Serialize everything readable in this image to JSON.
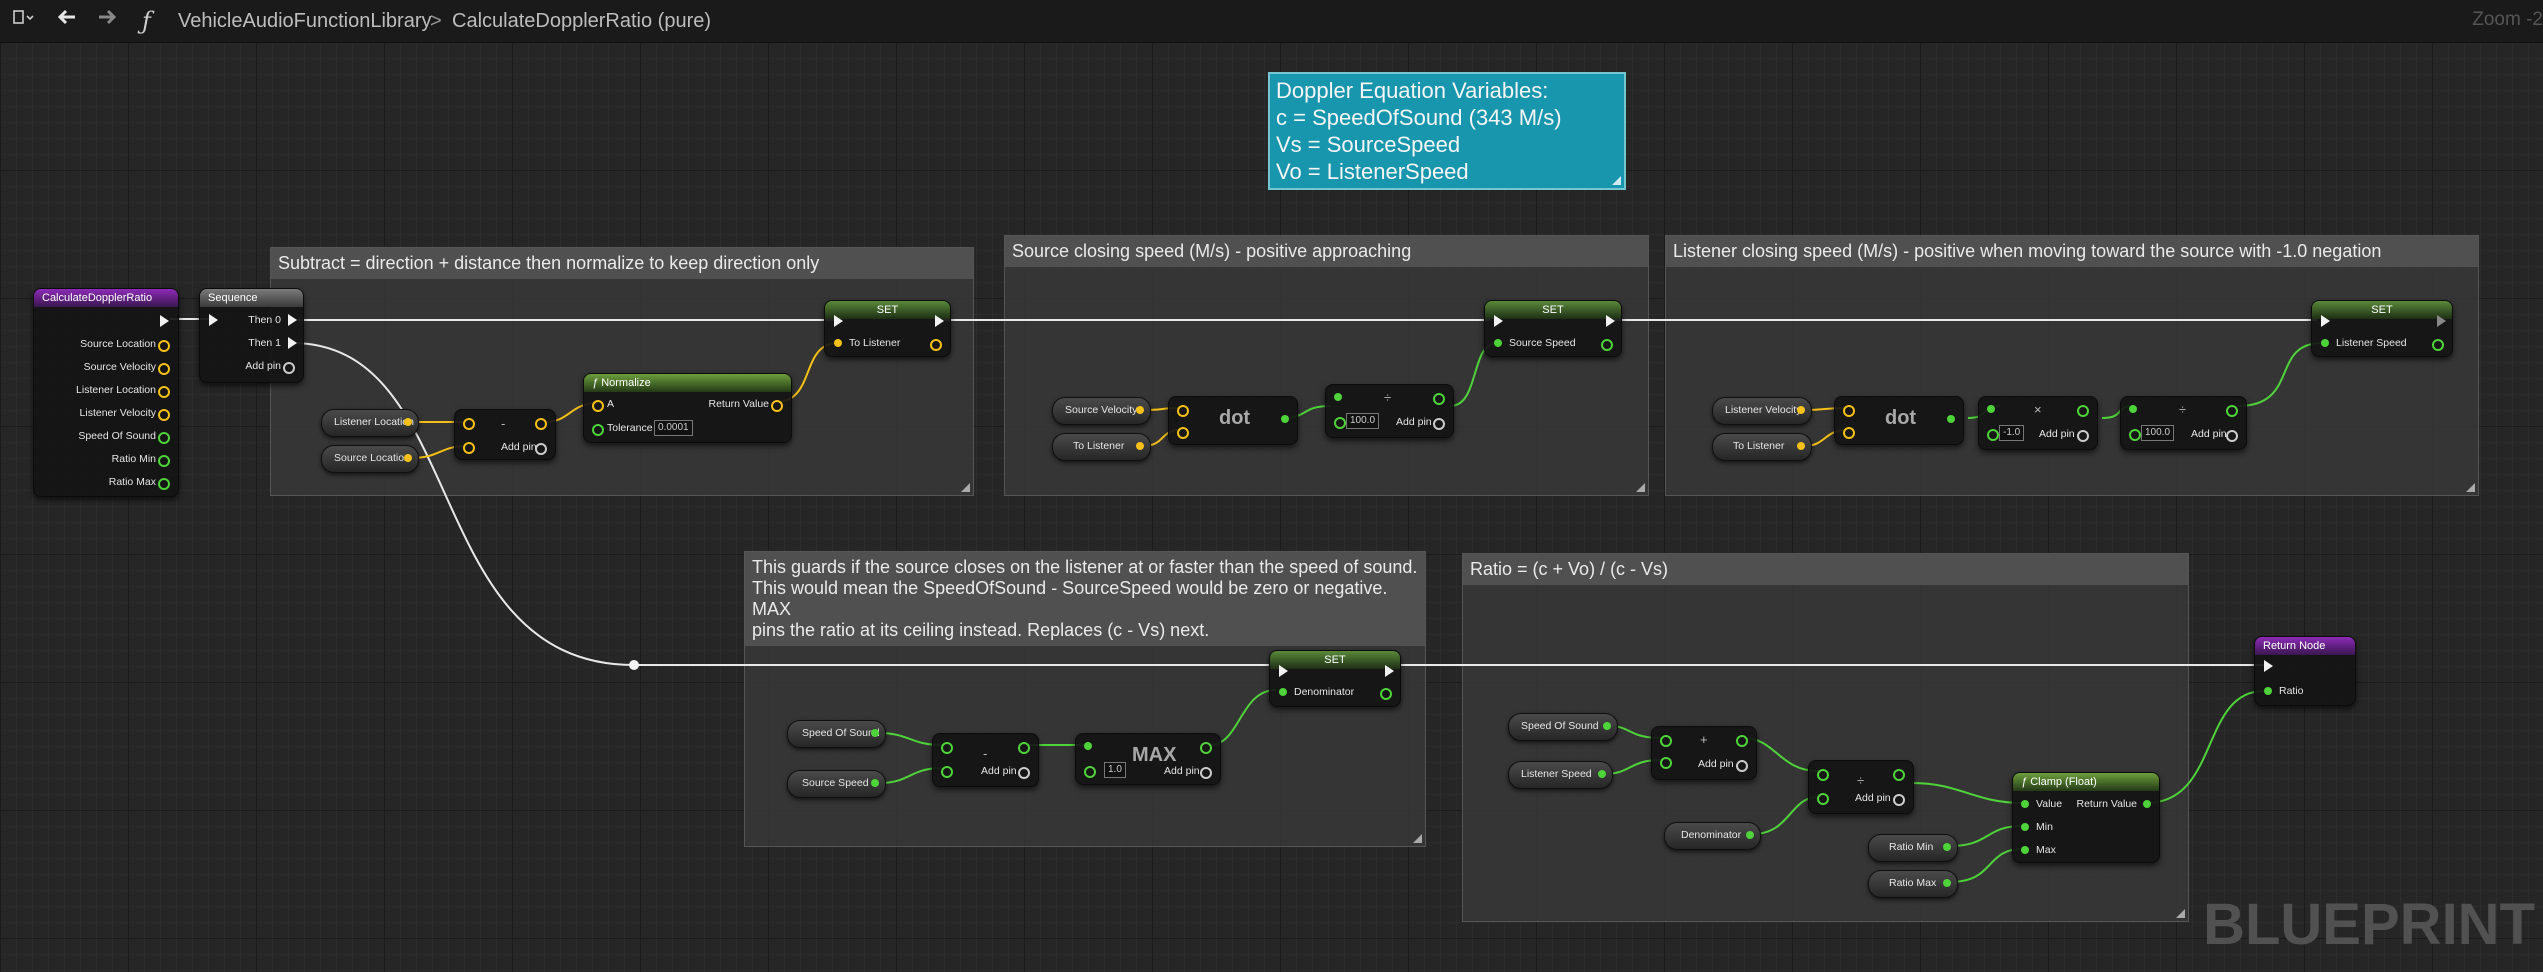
{
  "toolbar": {
    "breadcrumb_library": "VehicleAudioFunctionLibrary",
    "breadcrumb_separator": ">",
    "breadcrumb_function": "CalculateDopplerRatio (pure)",
    "zoom": "Zoom -2",
    "function_icon": "function-icon",
    "back_icon": "back-arrow-icon",
    "forward_icon": "forward-arrow-icon"
  },
  "watermark": "BLUEPRINT",
  "note": {
    "lines": [
      "Doppler Equation Variables:",
      "c = SpeedOfSound (343 M/s)",
      "Vs = SourceSpeed",
      "Vo = ListenerSpeed"
    ]
  },
  "comments": {
    "subtract": "Subtract = direction + distance then normalize to keep direction only",
    "source_closing": "Source closing speed (M/s) - positive approaching",
    "listener_closing": "Listener closing speed (M/s) - positive when moving toward the source with -1.0 negation",
    "guard_lines": [
      "This guards if the source closes on the listener at or faster than the speed of sound.",
      "This would mean the SpeedOfSound - SourceSpeed would be zero or negative. MAX",
      "pins the ratio at its ceiling instead. Replaces (c - Vs) next."
    ],
    "ratio": "Ratio = (c + Vo) / (c - Vs)"
  },
  "nodes": {
    "entry": {
      "title": "CalculateDopplerRatio",
      "pins": [
        "Source Location",
        "Source Velocity",
        "Listener Location",
        "Listener Velocity",
        "Speed Of Sound",
        "Ratio Min",
        "Ratio Max"
      ]
    },
    "sequence": {
      "title": "Sequence",
      "then0": "Then 0",
      "then1": "Then 1",
      "add_pin": "Add pin"
    },
    "listener_location": "Listener Location",
    "source_location": "Source Location",
    "subtract_op": "-",
    "add_pin": "Add pin",
    "normalize": {
      "title": "Normalize",
      "a": "A",
      "tolerance": "Tolerance",
      "tolerance_value": "0.0001",
      "return": "Return Value"
    },
    "set_to_listener": {
      "title": "SET",
      "pin": "To Listener"
    },
    "source_velocity": "Source Velocity",
    "to_listener": "To Listener",
    "dot": "dot",
    "divide_op": "÷",
    "div_value": "100.0",
    "set_source_speed": {
      "title": "SET",
      "pin": "Source Speed"
    },
    "listener_velocity": "Listener Velocity",
    "multiply_op": "×",
    "mul_value": "-1.0",
    "set_listener_speed": {
      "title": "SET",
      "pin": "Listener Speed"
    },
    "speed_of_sound": "Speed Of Sound",
    "source_speed": "Source Speed",
    "max": "MAX",
    "max_value": "1.0",
    "set_denominator": {
      "title": "SET",
      "pin": "Denominator"
    },
    "return_node": {
      "title": "Return Node",
      "pin": "Ratio"
    },
    "listener_speed": "Listener Speed",
    "plus_op": "+",
    "denominator": "Denominator",
    "ratio_min": "Ratio Min",
    "ratio_max": "Ratio Max",
    "clamp": {
      "title": "Clamp (Float)",
      "value": "Value",
      "min": "Min",
      "max": "Max",
      "return": "Return Value"
    }
  },
  "colors": {
    "exec": "#f2f2f2",
    "vector": "#f5c018",
    "float": "#4fd33a",
    "function_header": "#8d2bb8",
    "note": "#1896ad"
  }
}
